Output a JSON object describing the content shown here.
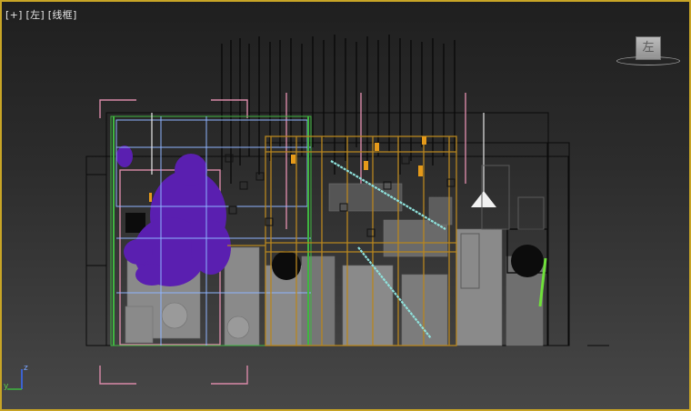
{
  "viewport": {
    "label": "[+] [左] [线框]",
    "frame_color": "#c8a526"
  },
  "viewcube": {
    "face_label": "左"
  },
  "axis_gizmo": {
    "z_label": "z",
    "x_label": "y"
  },
  "colors": {
    "furniture_gray": "#8a8a8a",
    "wire_black": "#0a0a0a",
    "purple_plant": "#5a1fb0",
    "wood_orange": "#b8861f",
    "pink_frame": "#d98aa8",
    "green_wire": "#3fb640",
    "light_blue": "#8fb4ff",
    "cyan_beam": "#8fe3dd"
  },
  "icons": [
    "viewcube-icon",
    "axis-gizmo-icon",
    "pendant-lamp-icon"
  ]
}
